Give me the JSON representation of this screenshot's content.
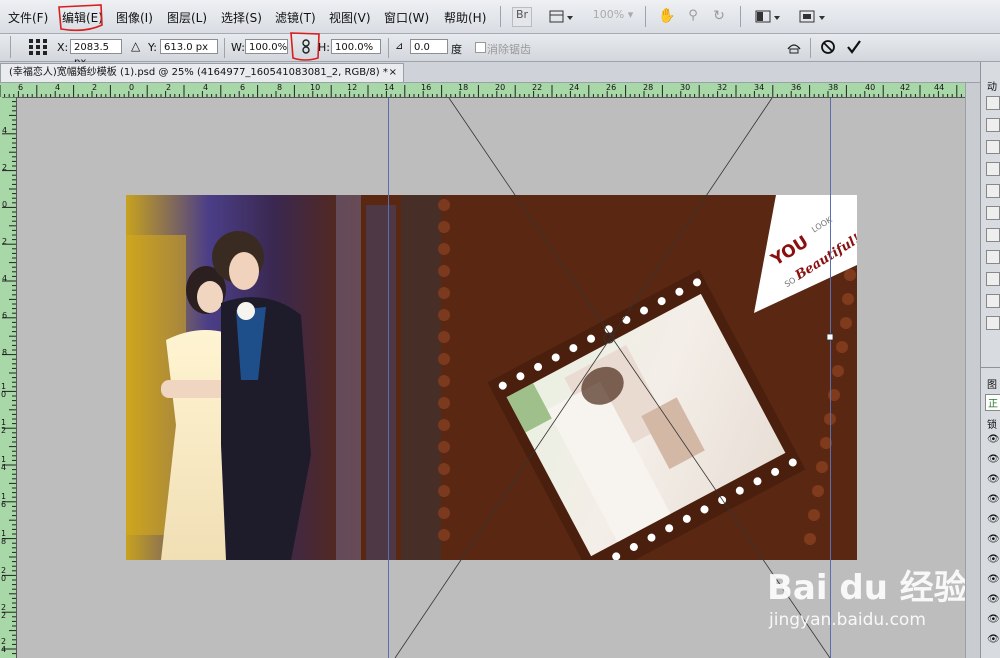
{
  "menu": {
    "items": [
      "文件(F)",
      "编辑(E)",
      "图像(I)",
      "图层(L)",
      "选择(S)",
      "滤镜(T)",
      "视图(V)",
      "窗口(W)",
      "帮助(H)"
    ],
    "br_label": "Br",
    "zoom_display": "100%"
  },
  "options": {
    "x_label": "X:",
    "x_value": "2083.5 px",
    "y_label": "Y:",
    "y_value": "613.0 px",
    "w_label": "W:",
    "w_value": "100.0%",
    "h_label": "H:",
    "h_value": "100.0%",
    "angle_value": "0.0",
    "angle_unit": "度",
    "antialias_label": "消除锯齿"
  },
  "document": {
    "tab_title": "(幸福恋人)宽幅婚纱模板 (1).psd @ 25% (4164977_160541083081_2, RGB/8) *",
    "close_label": "×"
  },
  "ruler": {
    "h_ticks": [
      "6",
      "4",
      "2",
      "0",
      "2",
      "4",
      "6",
      "8",
      "10",
      "12",
      "14",
      "16",
      "18",
      "20",
      "22",
      "24",
      "26",
      "28",
      "30",
      "32",
      "34",
      "36",
      "38",
      "40",
      "42",
      "44"
    ],
    "v_ticks": [
      "4",
      "2",
      "0",
      "2",
      "4",
      "6",
      "8",
      "10",
      "12",
      "14",
      "16",
      "18",
      "20",
      "22",
      "24"
    ]
  },
  "canvas": {
    "caption_you": "YOU",
    "caption_look": "LOOK",
    "caption_so": "SO",
    "caption_beautiful": "Beautiful!"
  },
  "panel": {
    "top_label": "动",
    "layers_label": "图",
    "zheng_label": "正",
    "lock_label": "锁"
  },
  "watermark": {
    "brand": "Bai du 经验",
    "url": "jingyan.baidu.com"
  },
  "colors": {
    "ruler_green": "#a8d8a8",
    "canvas_brown": "#5a2812",
    "annotation_red": "#d81e1e"
  }
}
